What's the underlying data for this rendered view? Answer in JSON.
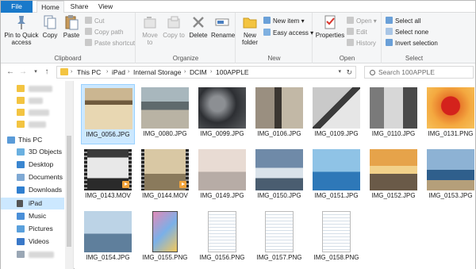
{
  "tabs": {
    "file": "File",
    "home": "Home",
    "share": "Share",
    "view": "View"
  },
  "ribbon": {
    "clipboard": {
      "group_label": "Clipboard",
      "pin": "Pin to Quick access",
      "copy": "Copy",
      "paste": "Paste",
      "cut": "Cut",
      "copy_path": "Copy path",
      "paste_shortcut": "Paste shortcut"
    },
    "organize": {
      "group_label": "Organize",
      "move_to": "Move to",
      "copy_to": "Copy to",
      "delete": "Delete",
      "rename": "Rename"
    },
    "new": {
      "group_label": "New",
      "new_folder": "New folder",
      "new_item": "New item",
      "easy_access": "Easy access"
    },
    "open": {
      "group_label": "Open",
      "properties": "Properties",
      "open": "Open",
      "edit": "Edit",
      "history": "History"
    },
    "select": {
      "group_label": "Select",
      "select_all": "Select all",
      "select_none": "Select none",
      "invert": "Invert selection"
    }
  },
  "address": {
    "crumbs": [
      "This PC",
      "iPad",
      "Internal Storage",
      "DCIM",
      "100APPLE"
    ],
    "search_placeholder": "Search 100APPLE"
  },
  "nav": {
    "items": [
      {
        "label": "This PC",
        "icon": "computer-icon"
      },
      {
        "label": "3D Objects",
        "icon": "cube-icon"
      },
      {
        "label": "Desktop",
        "icon": "desktop-icon"
      },
      {
        "label": "Documents",
        "icon": "documents-icon"
      },
      {
        "label": "Downloads",
        "icon": "download-icon"
      },
      {
        "label": "iPad",
        "icon": "ipad-icon"
      },
      {
        "label": "Music",
        "icon": "music-icon"
      },
      {
        "label": "Pictures",
        "icon": "pictures-icon"
      },
      {
        "label": "Videos",
        "icon": "videos-icon"
      }
    ]
  },
  "files": [
    {
      "name": "IMG_0056.JPG",
      "type": "photo"
    },
    {
      "name": "IMG_0080.JPG",
      "type": "photo"
    },
    {
      "name": "IMG_0099.JPG",
      "type": "photo"
    },
    {
      "name": "IMG_0106.JPG",
      "type": "photo"
    },
    {
      "name": "IMG_0109.JPG",
      "type": "photo"
    },
    {
      "name": "IMG_0110.JPG",
      "type": "photo"
    },
    {
      "name": "IMG_0131.PNG",
      "type": "photo"
    },
    {
      "name": "IMG_0143.MOV",
      "type": "video"
    },
    {
      "name": "IMG_0144.MOV",
      "type": "video"
    },
    {
      "name": "IMG_0149.JPG",
      "type": "photo"
    },
    {
      "name": "IMG_0150.JPG",
      "type": "photo"
    },
    {
      "name": "IMG_0151.JPG",
      "type": "photo"
    },
    {
      "name": "IMG_0152.JPG",
      "type": "photo"
    },
    {
      "name": "IMG_0153.JPG",
      "type": "photo"
    },
    {
      "name": "IMG_0154.JPG",
      "type": "photo"
    },
    {
      "name": "IMG_0155.PNG",
      "type": "screenshot"
    },
    {
      "name": "IMG_0156.PNG",
      "type": "screenshot"
    },
    {
      "name": "IMG_0157.PNG",
      "type": "screenshot"
    },
    {
      "name": "IMG_0158.PNG",
      "type": "screenshot"
    }
  ],
  "colors": {
    "accent": "#1979ca",
    "selection": "#cce8ff",
    "folder": "#f3c441"
  }
}
